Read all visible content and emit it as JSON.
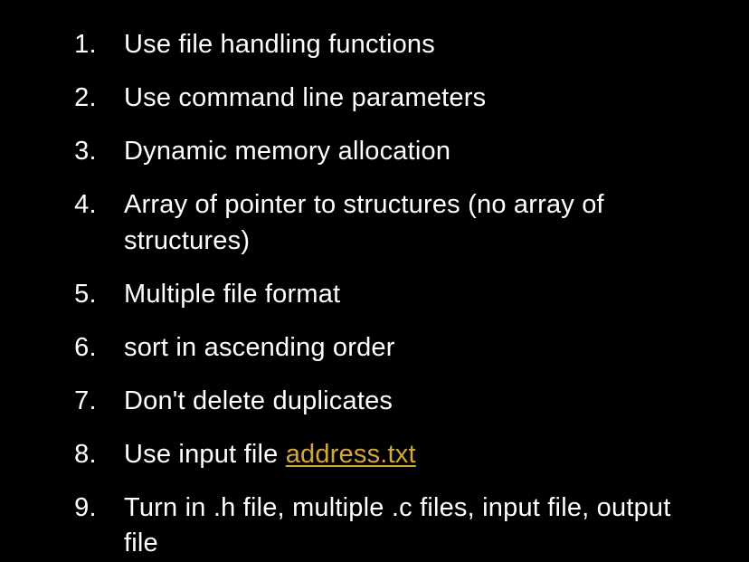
{
  "list": {
    "items": [
      {
        "text": "Use file handling functions"
      },
      {
        "text": "Use command line parameters"
      },
      {
        "text": "Dynamic memory allocation"
      },
      {
        "text": "Array of pointer to structures (no array of structures)"
      },
      {
        "text": "Multiple file format"
      },
      {
        "text": "sort in ascending order"
      },
      {
        "text": "Don't delete duplicates"
      },
      {
        "prefix": "Use input file ",
        "link_text": "address.txt"
      },
      {
        "text": "Turn in .h file, multiple .c files, input file, output file"
      }
    ]
  }
}
